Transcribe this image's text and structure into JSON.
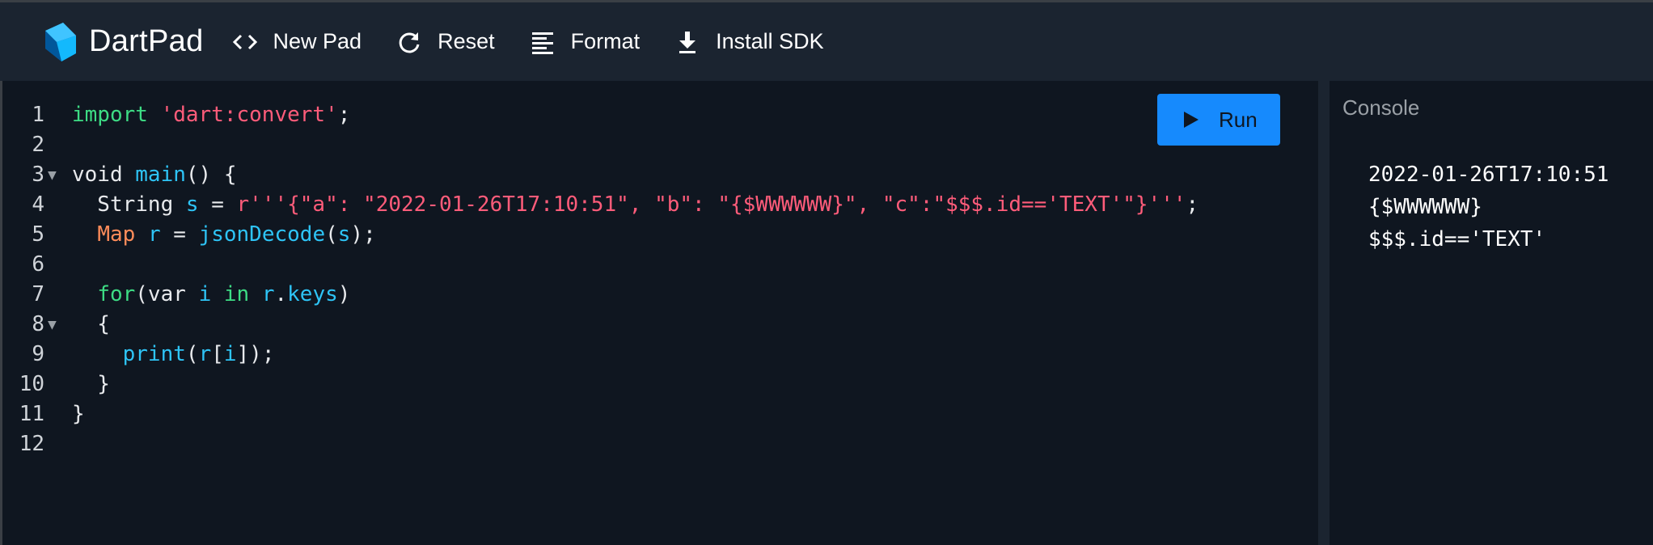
{
  "app": {
    "brand": "DartPad"
  },
  "toolbar": {
    "new_pad": "New Pad",
    "reset": "Reset",
    "format": "Format",
    "install_sdk": "Install SDK"
  },
  "editor": {
    "run_label": "Run",
    "line_numbers": [
      "1",
      "2",
      "3",
      "4",
      "5",
      "6",
      "7",
      "8",
      "9",
      "10",
      "11",
      "12"
    ],
    "lines": [
      [
        {
          "t": "import",
          "c": "kw-green"
        },
        {
          "t": " ",
          "c": "pl"
        },
        {
          "t": "'dart:convert'",
          "c": "str"
        },
        {
          "t": ";",
          "c": "pl"
        }
      ],
      [],
      [
        {
          "t": "void ",
          "c": "pl"
        },
        {
          "t": "main",
          "c": "fn"
        },
        {
          "t": "() {",
          "c": "pl"
        }
      ],
      [
        {
          "t": "  String ",
          "c": "pl"
        },
        {
          "t": "s",
          "c": "fn"
        },
        {
          "t": " = ",
          "c": "pl"
        },
        {
          "t": "r'''{\"a\": \"2022-01-26T17:10:51\", \"b\": \"{$WWWWWW}\", \"c\":\"$$$.id=='TEXT'\"}'''",
          "c": "str"
        },
        {
          "t": ";",
          "c": "pl"
        }
      ],
      [
        {
          "t": "  ",
          "c": "pl"
        },
        {
          "t": "Map",
          "c": "ty"
        },
        {
          "t": " ",
          "c": "pl"
        },
        {
          "t": "r",
          "c": "fn"
        },
        {
          "t": " = ",
          "c": "pl"
        },
        {
          "t": "jsonDecode",
          "c": "fn"
        },
        {
          "t": "(",
          "c": "pl"
        },
        {
          "t": "s",
          "c": "fn"
        },
        {
          "t": ");",
          "c": "pl"
        }
      ],
      [],
      [
        {
          "t": "  ",
          "c": "pl"
        },
        {
          "t": "for",
          "c": "kw-green"
        },
        {
          "t": "(var ",
          "c": "pl"
        },
        {
          "t": "i",
          "c": "fn"
        },
        {
          "t": " ",
          "c": "pl"
        },
        {
          "t": "in",
          "c": "kw-green"
        },
        {
          "t": " ",
          "c": "pl"
        },
        {
          "t": "r",
          "c": "fn"
        },
        {
          "t": ".",
          "c": "pl"
        },
        {
          "t": "keys",
          "c": "fn"
        },
        {
          "t": ")",
          "c": "pl"
        }
      ],
      [
        {
          "t": "  {",
          "c": "pl"
        }
      ],
      [
        {
          "t": "    ",
          "c": "pl"
        },
        {
          "t": "print",
          "c": "fn"
        },
        {
          "t": "(",
          "c": "pl"
        },
        {
          "t": "r",
          "c": "fn"
        },
        {
          "t": "[",
          "c": "pl"
        },
        {
          "t": "i",
          "c": "fn"
        },
        {
          "t": "]);",
          "c": "pl"
        }
      ],
      [
        {
          "t": "  }",
          "c": "pl"
        }
      ],
      [
        {
          "t": "}",
          "c": "pl"
        }
      ],
      []
    ],
    "fold_markers": [
      "3",
      "8"
    ]
  },
  "console": {
    "title": "Console",
    "output": [
      "2022-01-26T17:10:51",
      "{$WWWWWW}",
      "$$$.id=='TEXT'"
    ]
  },
  "colors": {
    "topbar": "#1b2430",
    "background": "#0f1620",
    "run_button": "#168afd",
    "keyword": "#3ddc84",
    "string": "#ff5c7a",
    "identifier": "#2ec4f6",
    "type": "#ff8c5a"
  },
  "icons": [
    "dart-logo-icon",
    "code-brackets-icon",
    "refresh-icon",
    "format-lines-icon",
    "download-icon",
    "play-icon"
  ]
}
